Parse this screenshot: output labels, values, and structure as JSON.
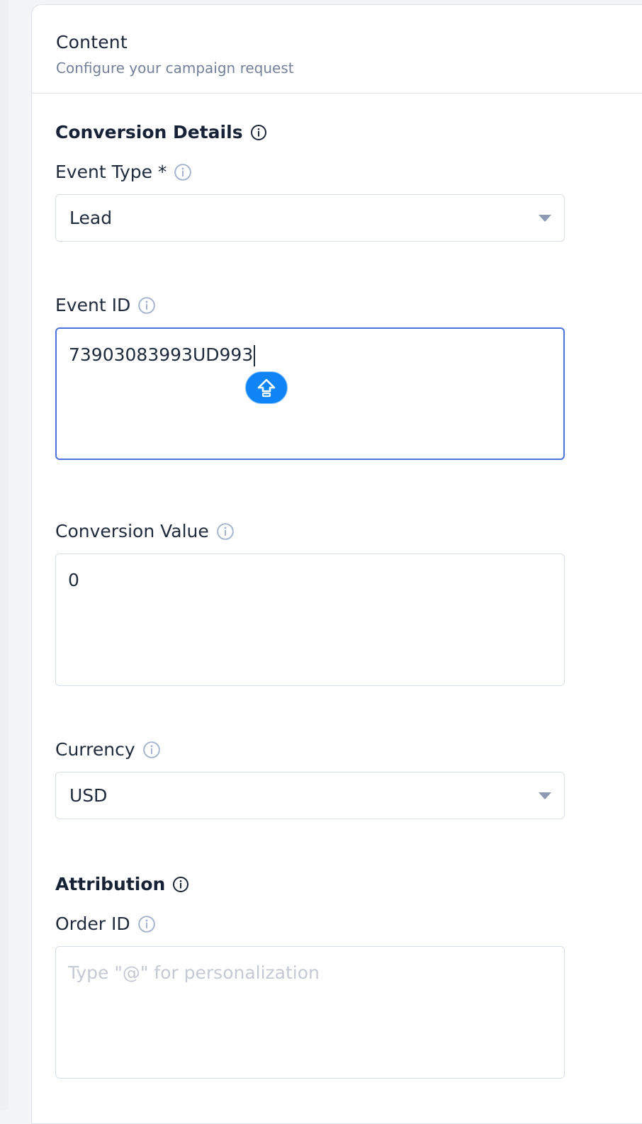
{
  "header": {
    "title": "Content",
    "subtitle": "Configure your campaign request"
  },
  "conversion_details": {
    "title": "Conversion Details",
    "event_type": {
      "label": "Event Type *",
      "value": "Lead"
    },
    "event_id": {
      "label": "Event ID",
      "value": "73903083993UD993"
    },
    "conversion_value": {
      "label": "Conversion Value",
      "value": "0"
    },
    "currency": {
      "label": "Currency",
      "value": "USD"
    }
  },
  "attribution": {
    "title": "Attribution",
    "order_id": {
      "label": "Order ID",
      "value": "",
      "placeholder": "Type \"@\" for personalization"
    }
  },
  "icons": {
    "info": "info-circle-icon",
    "caret": "caret-down-icon",
    "keyboard_shift": "shift-arrow-icon"
  },
  "colors": {
    "focus_border": "#4a74db",
    "badge_blue": "#0f84f7",
    "info_light": "#a4b3cf"
  }
}
